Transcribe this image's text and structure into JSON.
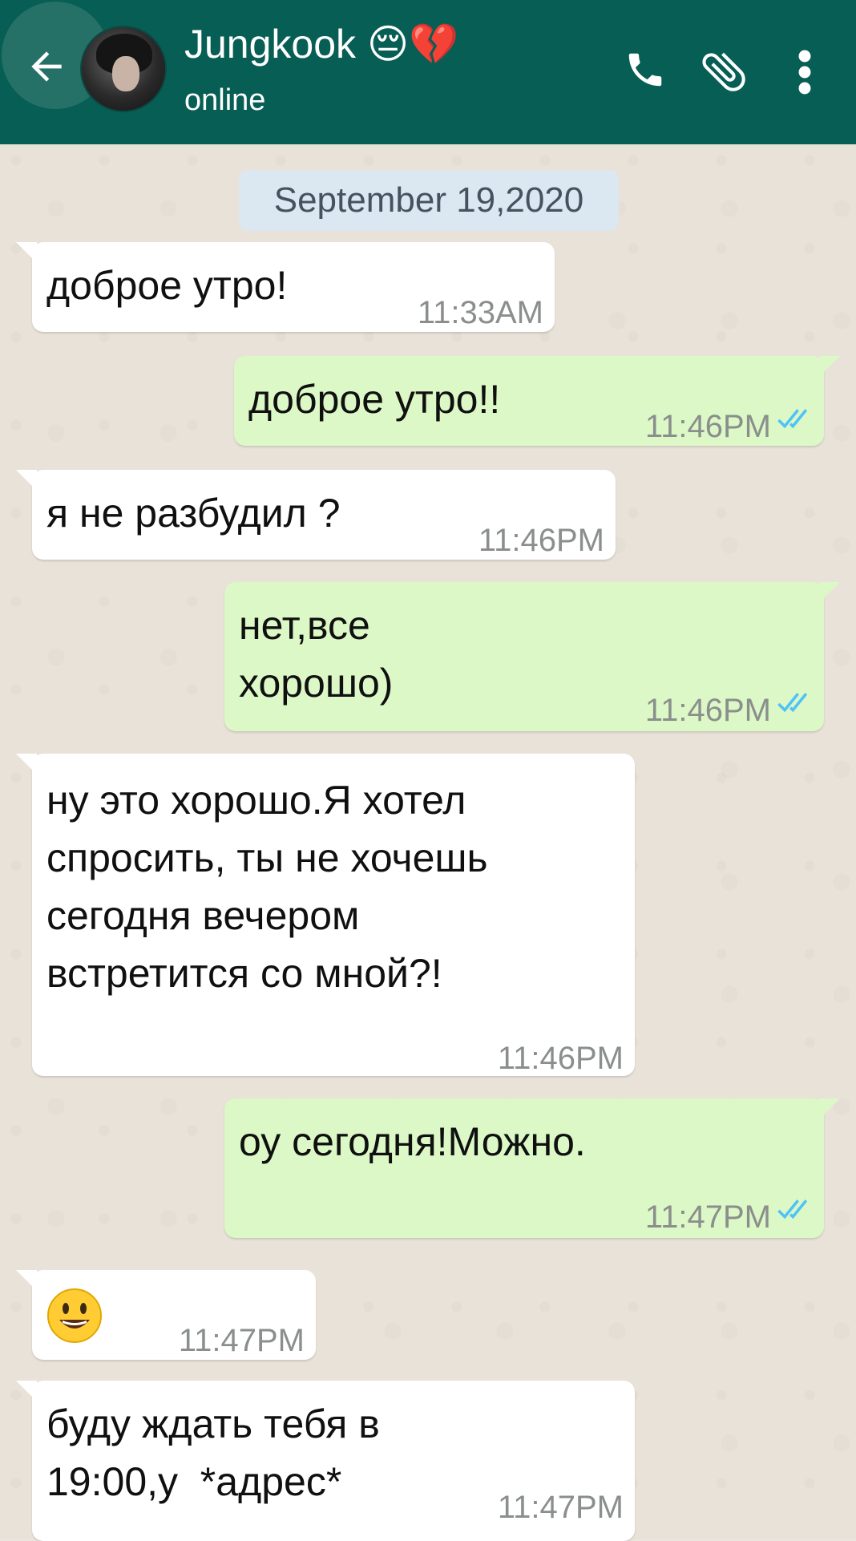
{
  "header": {
    "contact_name": "Jungkook",
    "name_emoji": "😔💔",
    "status": "online",
    "background_color": "#075e54"
  },
  "icons": {
    "back": "arrow-left-icon",
    "call": "phone-icon",
    "attach": "paperclip-icon",
    "menu": "more-vert-icon",
    "read_receipt": "double-check-icon"
  },
  "chat": {
    "date_chip": "September 19,2020",
    "messages": [
      {
        "direction": "in",
        "text": "доброе утро!",
        "time": "11:33AM"
      },
      {
        "direction": "out",
        "text": "доброе утро!!",
        "time": "11:46PM",
        "read": true
      },
      {
        "direction": "in",
        "text": "я не разбудил ?",
        "time": "11:46PM"
      },
      {
        "direction": "out",
        "text": "нет,все\nхорошо)",
        "time": "11:46PM",
        "read": true
      },
      {
        "direction": "in",
        "text": "ну это хорошо.Я хотел\nспросить, ты не хочешь\nсегодня вечером\nвстретится со мной?!",
        "time": "11:46PM"
      },
      {
        "direction": "out",
        "text": "оу сегодня!Можно.",
        "time": "11:47PM",
        "read": true
      },
      {
        "direction": "in",
        "emoji": "smiley-face-icon",
        "time": "11:47PM"
      },
      {
        "direction": "in",
        "text": "буду ждать тебя в\n19:00,у  *адрес*",
        "time": "11:47PM"
      }
    ]
  },
  "colors": {
    "incoming_bubble": "#ffffff",
    "outgoing_bubble": "#dcf8c6",
    "read_tick": "#4fc3f7",
    "chat_background": "#e9e2d8"
  }
}
